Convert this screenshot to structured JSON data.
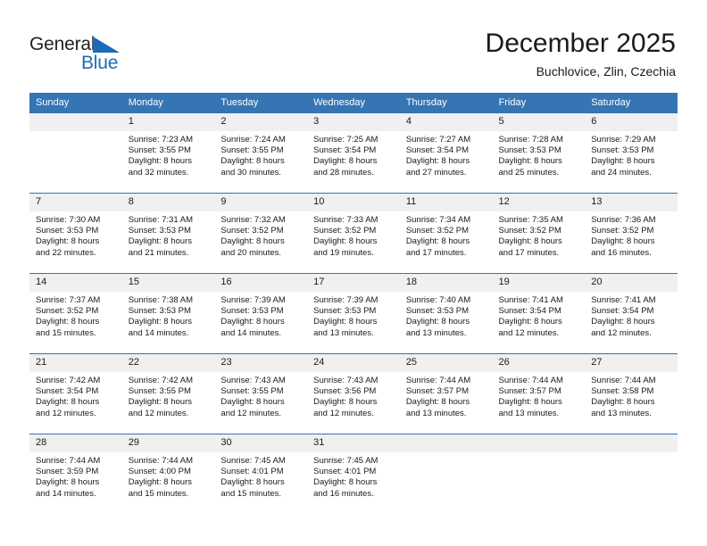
{
  "brand": {
    "name_part1": "General",
    "name_part2": "Blue",
    "triangle_icon": "triangle-icon",
    "color_dark": "#231f20",
    "color_blue": "#1b6cb5"
  },
  "header": {
    "title": "December 2025",
    "subtitle": "Buchlovice, Zlin, Czechia"
  },
  "theme": {
    "header_blue": "#3575b4",
    "row_rule_blue": "#2f74b5",
    "daynum_bg": "#f0f0f0"
  },
  "calendar": {
    "weekday_headers": [
      "Sunday",
      "Monday",
      "Tuesday",
      "Wednesday",
      "Thursday",
      "Friday",
      "Saturday"
    ],
    "weeks": [
      [
        {
          "day": "",
          "lines": []
        },
        {
          "day": "1",
          "lines": [
            "Sunrise: 7:23 AM",
            "Sunset: 3:55 PM",
            "Daylight: 8 hours",
            "and 32 minutes."
          ]
        },
        {
          "day": "2",
          "lines": [
            "Sunrise: 7:24 AM",
            "Sunset: 3:55 PM",
            "Daylight: 8 hours",
            "and 30 minutes."
          ]
        },
        {
          "day": "3",
          "lines": [
            "Sunrise: 7:25 AM",
            "Sunset: 3:54 PM",
            "Daylight: 8 hours",
            "and 28 minutes."
          ]
        },
        {
          "day": "4",
          "lines": [
            "Sunrise: 7:27 AM",
            "Sunset: 3:54 PM",
            "Daylight: 8 hours",
            "and 27 minutes."
          ]
        },
        {
          "day": "5",
          "lines": [
            "Sunrise: 7:28 AM",
            "Sunset: 3:53 PM",
            "Daylight: 8 hours",
            "and 25 minutes."
          ]
        },
        {
          "day": "6",
          "lines": [
            "Sunrise: 7:29 AM",
            "Sunset: 3:53 PM",
            "Daylight: 8 hours",
            "and 24 minutes."
          ]
        }
      ],
      [
        {
          "day": "7",
          "lines": [
            "Sunrise: 7:30 AM",
            "Sunset: 3:53 PM",
            "Daylight: 8 hours",
            "and 22 minutes."
          ]
        },
        {
          "day": "8",
          "lines": [
            "Sunrise: 7:31 AM",
            "Sunset: 3:53 PM",
            "Daylight: 8 hours",
            "and 21 minutes."
          ]
        },
        {
          "day": "9",
          "lines": [
            "Sunrise: 7:32 AM",
            "Sunset: 3:52 PM",
            "Daylight: 8 hours",
            "and 20 minutes."
          ]
        },
        {
          "day": "10",
          "lines": [
            "Sunrise: 7:33 AM",
            "Sunset: 3:52 PM",
            "Daylight: 8 hours",
            "and 19 minutes."
          ]
        },
        {
          "day": "11",
          "lines": [
            "Sunrise: 7:34 AM",
            "Sunset: 3:52 PM",
            "Daylight: 8 hours",
            "and 17 minutes."
          ]
        },
        {
          "day": "12",
          "lines": [
            "Sunrise: 7:35 AM",
            "Sunset: 3:52 PM",
            "Daylight: 8 hours",
            "and 17 minutes."
          ]
        },
        {
          "day": "13",
          "lines": [
            "Sunrise: 7:36 AM",
            "Sunset: 3:52 PM",
            "Daylight: 8 hours",
            "and 16 minutes."
          ]
        }
      ],
      [
        {
          "day": "14",
          "lines": [
            "Sunrise: 7:37 AM",
            "Sunset: 3:52 PM",
            "Daylight: 8 hours",
            "and 15 minutes."
          ]
        },
        {
          "day": "15",
          "lines": [
            "Sunrise: 7:38 AM",
            "Sunset: 3:53 PM",
            "Daylight: 8 hours",
            "and 14 minutes."
          ]
        },
        {
          "day": "16",
          "lines": [
            "Sunrise: 7:39 AM",
            "Sunset: 3:53 PM",
            "Daylight: 8 hours",
            "and 14 minutes."
          ]
        },
        {
          "day": "17",
          "lines": [
            "Sunrise: 7:39 AM",
            "Sunset: 3:53 PM",
            "Daylight: 8 hours",
            "and 13 minutes."
          ]
        },
        {
          "day": "18",
          "lines": [
            "Sunrise: 7:40 AM",
            "Sunset: 3:53 PM",
            "Daylight: 8 hours",
            "and 13 minutes."
          ]
        },
        {
          "day": "19",
          "lines": [
            "Sunrise: 7:41 AM",
            "Sunset: 3:54 PM",
            "Daylight: 8 hours",
            "and 12 minutes."
          ]
        },
        {
          "day": "20",
          "lines": [
            "Sunrise: 7:41 AM",
            "Sunset: 3:54 PM",
            "Daylight: 8 hours",
            "and 12 minutes."
          ]
        }
      ],
      [
        {
          "day": "21",
          "lines": [
            "Sunrise: 7:42 AM",
            "Sunset: 3:54 PM",
            "Daylight: 8 hours",
            "and 12 minutes."
          ]
        },
        {
          "day": "22",
          "lines": [
            "Sunrise: 7:42 AM",
            "Sunset: 3:55 PM",
            "Daylight: 8 hours",
            "and 12 minutes."
          ]
        },
        {
          "day": "23",
          "lines": [
            "Sunrise: 7:43 AM",
            "Sunset: 3:55 PM",
            "Daylight: 8 hours",
            "and 12 minutes."
          ]
        },
        {
          "day": "24",
          "lines": [
            "Sunrise: 7:43 AM",
            "Sunset: 3:56 PM",
            "Daylight: 8 hours",
            "and 12 minutes."
          ]
        },
        {
          "day": "25",
          "lines": [
            "Sunrise: 7:44 AM",
            "Sunset: 3:57 PM",
            "Daylight: 8 hours",
            "and 13 minutes."
          ]
        },
        {
          "day": "26",
          "lines": [
            "Sunrise: 7:44 AM",
            "Sunset: 3:57 PM",
            "Daylight: 8 hours",
            "and 13 minutes."
          ]
        },
        {
          "day": "27",
          "lines": [
            "Sunrise: 7:44 AM",
            "Sunset: 3:58 PM",
            "Daylight: 8 hours",
            "and 13 minutes."
          ]
        }
      ],
      [
        {
          "day": "28",
          "lines": [
            "Sunrise: 7:44 AM",
            "Sunset: 3:59 PM",
            "Daylight: 8 hours",
            "and 14 minutes."
          ]
        },
        {
          "day": "29",
          "lines": [
            "Sunrise: 7:44 AM",
            "Sunset: 4:00 PM",
            "Daylight: 8 hours",
            "and 15 minutes."
          ]
        },
        {
          "day": "30",
          "lines": [
            "Sunrise: 7:45 AM",
            "Sunset: 4:01 PM",
            "Daylight: 8 hours",
            "and 15 minutes."
          ]
        },
        {
          "day": "31",
          "lines": [
            "Sunrise: 7:45 AM",
            "Sunset: 4:01 PM",
            "Daylight: 8 hours",
            "and 16 minutes."
          ]
        },
        {
          "day": "",
          "lines": []
        },
        {
          "day": "",
          "lines": []
        },
        {
          "day": "",
          "lines": []
        }
      ]
    ]
  }
}
